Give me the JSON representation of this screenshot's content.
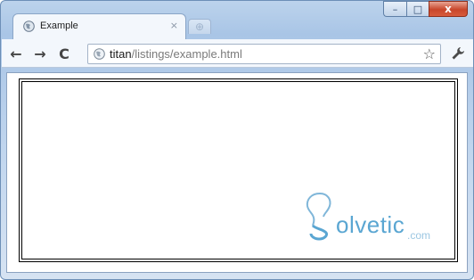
{
  "window": {
    "caption": {
      "minimize": "–",
      "maximize": "□",
      "close": "x"
    }
  },
  "tabs": [
    {
      "title": "Example",
      "close": "×",
      "favicon": "globe-icon"
    }
  ],
  "new_tab": {
    "label": "⊕"
  },
  "toolbar": {
    "back": "←",
    "forward": "→",
    "reload": "C",
    "wrench": "🔧"
  },
  "address_bar": {
    "host": "titan",
    "path": "/listings/example.html",
    "icon": "globe-icon",
    "star": "☆"
  },
  "page": {
    "watermark": {
      "word": "olvetic",
      "suffix": ".com"
    }
  },
  "colors": {
    "accent": "#5aa6d2",
    "close_button": "#c8462b"
  }
}
